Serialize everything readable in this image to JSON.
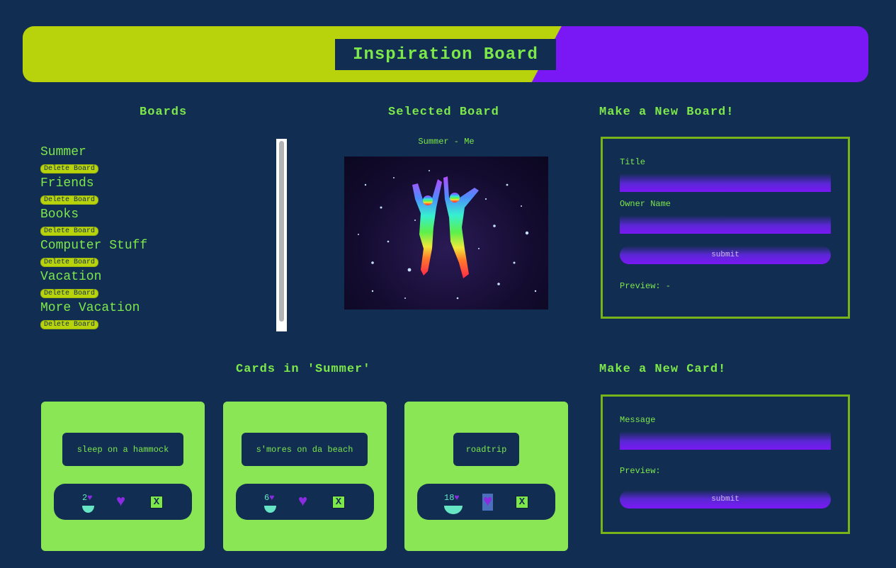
{
  "header": {
    "title": "Inspiration Board"
  },
  "colors": {
    "background": "#122d52",
    "accent_green": "#7de84a",
    "lime": "#b8d30b",
    "purple": "#7a18f5",
    "card_green": "#8be655"
  },
  "boards_panel": {
    "heading": "Boards",
    "delete_label": "Delete Board",
    "boards": [
      {
        "name": "Summer"
      },
      {
        "name": "Friends"
      },
      {
        "name": "Books"
      },
      {
        "name": "Computer Stuff"
      },
      {
        "name": "Vacation"
      },
      {
        "name": "More Vacation"
      }
    ]
  },
  "selected_panel": {
    "heading": "Selected Board",
    "caption": "Summer - Me",
    "image_icon": "rainbow-dancers-image"
  },
  "new_board": {
    "heading": "Make a New Board!",
    "title_label": "Title",
    "owner_label": "Owner Name",
    "title_value": "",
    "owner_value": "",
    "submit_label": "submit",
    "preview_label": "Preview: -"
  },
  "cards_panel": {
    "heading": "Cards in 'Summer'",
    "cards": [
      {
        "message": "sleep on a hammock",
        "likes": "2",
        "heart_glyph": "♥",
        "delete_label": "X"
      },
      {
        "message": "s'mores on da beach",
        "likes": "6",
        "heart_glyph": "♥",
        "delete_label": "X"
      },
      {
        "message": "roadtrip",
        "likes": "18",
        "heart_glyph": "♥",
        "delete_label": "X"
      }
    ]
  },
  "new_card": {
    "heading": "Make a New Card!",
    "message_label": "Message",
    "message_value": "",
    "preview_label": "Preview:",
    "submit_label": "submit"
  }
}
